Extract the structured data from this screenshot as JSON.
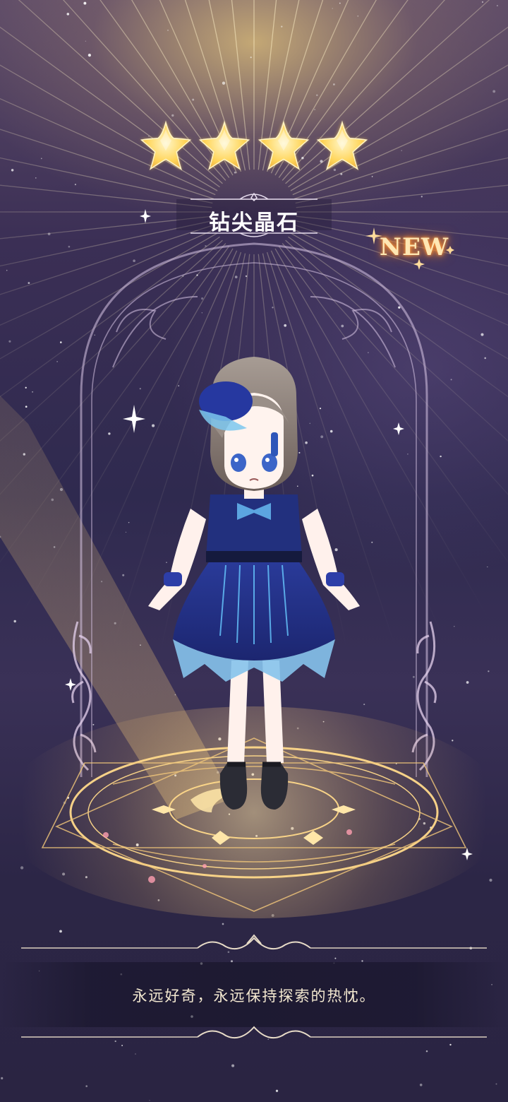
{
  "item": {
    "name": "钻尖晶石",
    "rarity_stars": 4,
    "badge": "NEW",
    "description": "永远好奇，永远保持探索的热忱。"
  },
  "colors": {
    "star_fill": "#ffd55a",
    "badge_glow": "#ff9a3d",
    "circle_gold": "#ffd98a",
    "dress_blue": "#1f2e84",
    "hair": "#9c9088"
  },
  "icons": {
    "rating": "star-icon",
    "sparkle": "sparkle-icon"
  }
}
